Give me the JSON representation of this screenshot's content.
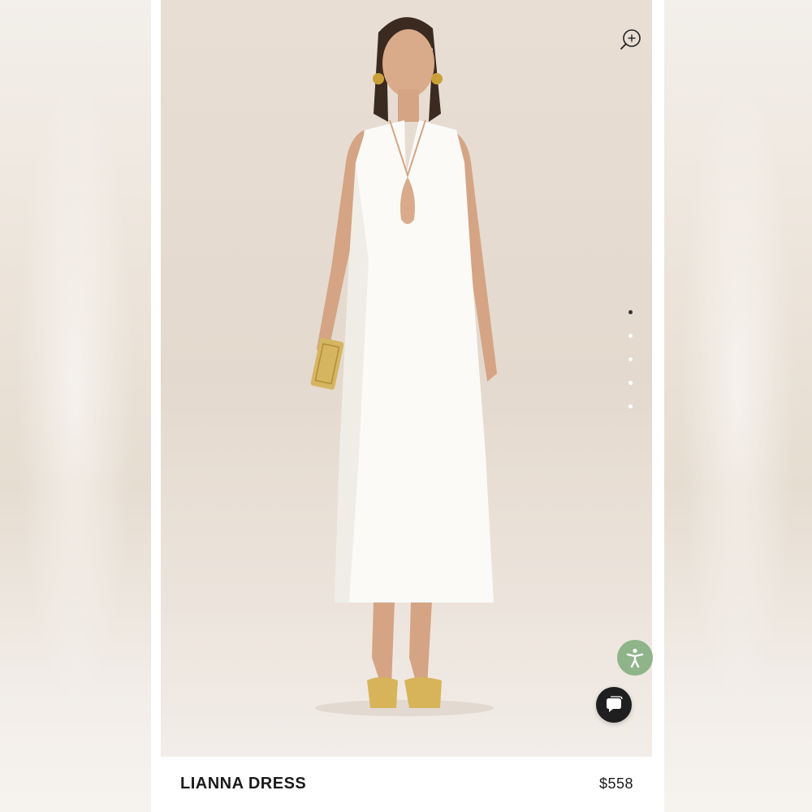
{
  "product": {
    "name": "LIANNA DRESS",
    "price": "$558"
  },
  "gallery": {
    "dot_count": 5,
    "active_index": 0
  },
  "icons": {
    "zoom": "zoom-in-icon",
    "accessibility": "accessibility-icon",
    "chat": "chat-bubble-icon"
  },
  "colors": {
    "accessibility_bg": "#8fb48a",
    "chat_bg": "#1f1f1f",
    "dot_active": "#333333",
    "dot_inactive": "#ffffff"
  }
}
